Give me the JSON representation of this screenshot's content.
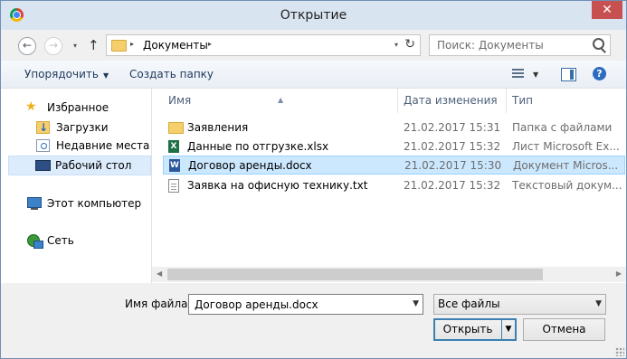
{
  "window": {
    "title": "Открытие",
    "close_glyph": "✕",
    "app_icon": "chrome-icon"
  },
  "nav": {
    "back_glyph": "←",
    "forward_glyph": "→",
    "dropdown_glyph": "▾",
    "up_glyph": "↑",
    "address": {
      "path": "Документы",
      "sep": "▸",
      "refresh_glyph": "↻"
    },
    "search": {
      "placeholder": "Поиск: Документы"
    }
  },
  "toolbar": {
    "organize_label": "Упорядочить",
    "new_folder_label": "Создать папку",
    "dd_glyph": "▼",
    "help_glyph": "?"
  },
  "sidebar": {
    "items": [
      {
        "label": "Избранное",
        "icon": "star-icon"
      },
      {
        "label": "Загрузки",
        "icon": "downloads-folder-icon"
      },
      {
        "label": "Недавние места",
        "icon": "recent-places-icon"
      },
      {
        "label": "Рабочий стол",
        "icon": "desktop-icon",
        "selected": true
      },
      {
        "label": "Этот компьютер",
        "icon": "computer-icon"
      },
      {
        "label": "Сеть",
        "icon": "network-icon"
      }
    ]
  },
  "columns": {
    "name": "Имя",
    "date": "Дата изменения",
    "type": "Тип",
    "sort_glyph": "▲"
  },
  "files": [
    {
      "name": "Заявления",
      "date": "21.02.2017 15:31",
      "type": "Папка с файлами",
      "icon": "folder-icon"
    },
    {
      "name": "Данные по отгрузке.xlsx",
      "date": "21.02.2017 15:32",
      "type": "Лист Microsoft Ex...",
      "icon": "excel-icon",
      "icon_letter": "X"
    },
    {
      "name": "Договор аренды.docx",
      "date": "21.02.2017 15:30",
      "type": "Документ Micros...",
      "icon": "word-icon",
      "icon_letter": "W",
      "selected": true
    },
    {
      "name": "Заявка на офисную технику.txt",
      "date": "21.02.2017 15:32",
      "type": "Текстовый докум...",
      "icon": "text-file-icon"
    }
  ],
  "scroll": {
    "left_glyph": "◀",
    "right_glyph": "▶"
  },
  "bottom": {
    "filename_label": "Имя файла:",
    "filename_value": "Договор аренды.docx",
    "filter_value": "Все файлы",
    "combo_glyph": "▼",
    "open_label": "Открыть",
    "cancel_label": "Отмена"
  },
  "colors": {
    "selection": "#cce8ff",
    "title_bar": "#d9e4f1",
    "close": "#c75050"
  }
}
